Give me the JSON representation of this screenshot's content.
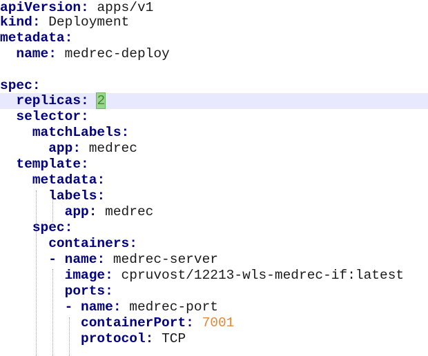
{
  "editor": {
    "lines": [
      {
        "key": "apiVersion",
        "value": "apps/v1"
      },
      {
        "key": "kind",
        "value": "Deployment"
      },
      {
        "key": "metadata",
        "value": ""
      },
      {
        "key": "name",
        "value": "medrec-deploy"
      },
      {
        "key": "spec",
        "value": ""
      },
      {
        "key": "replicas",
        "value": "2"
      },
      {
        "key": "selector",
        "value": ""
      },
      {
        "key": "matchLabels",
        "value": ""
      },
      {
        "key": "app",
        "value": "medrec"
      },
      {
        "key": "template",
        "value": ""
      },
      {
        "key": "metadata",
        "value": ""
      },
      {
        "key": "labels",
        "value": ""
      },
      {
        "key": "app",
        "value": "medrec"
      },
      {
        "key": "spec",
        "value": ""
      },
      {
        "key": "containers",
        "value": ""
      },
      {
        "key": "name",
        "value": "medrec-server"
      },
      {
        "key": "image",
        "value": "cpruvost/12213-wls-medrec-if:latest"
      },
      {
        "key": "ports",
        "value": ""
      },
      {
        "key": "name",
        "value": "medrec-port"
      },
      {
        "key": "containerPort",
        "value": "7001"
      },
      {
        "key": "protocol",
        "value": "TCP"
      }
    ],
    "dash": "-",
    "colon": ":",
    "colors": {
      "key": "#000080",
      "number": "#e08a3c",
      "current_line": "#e8e8ff",
      "caret_highlight": "#9bd48f"
    }
  }
}
